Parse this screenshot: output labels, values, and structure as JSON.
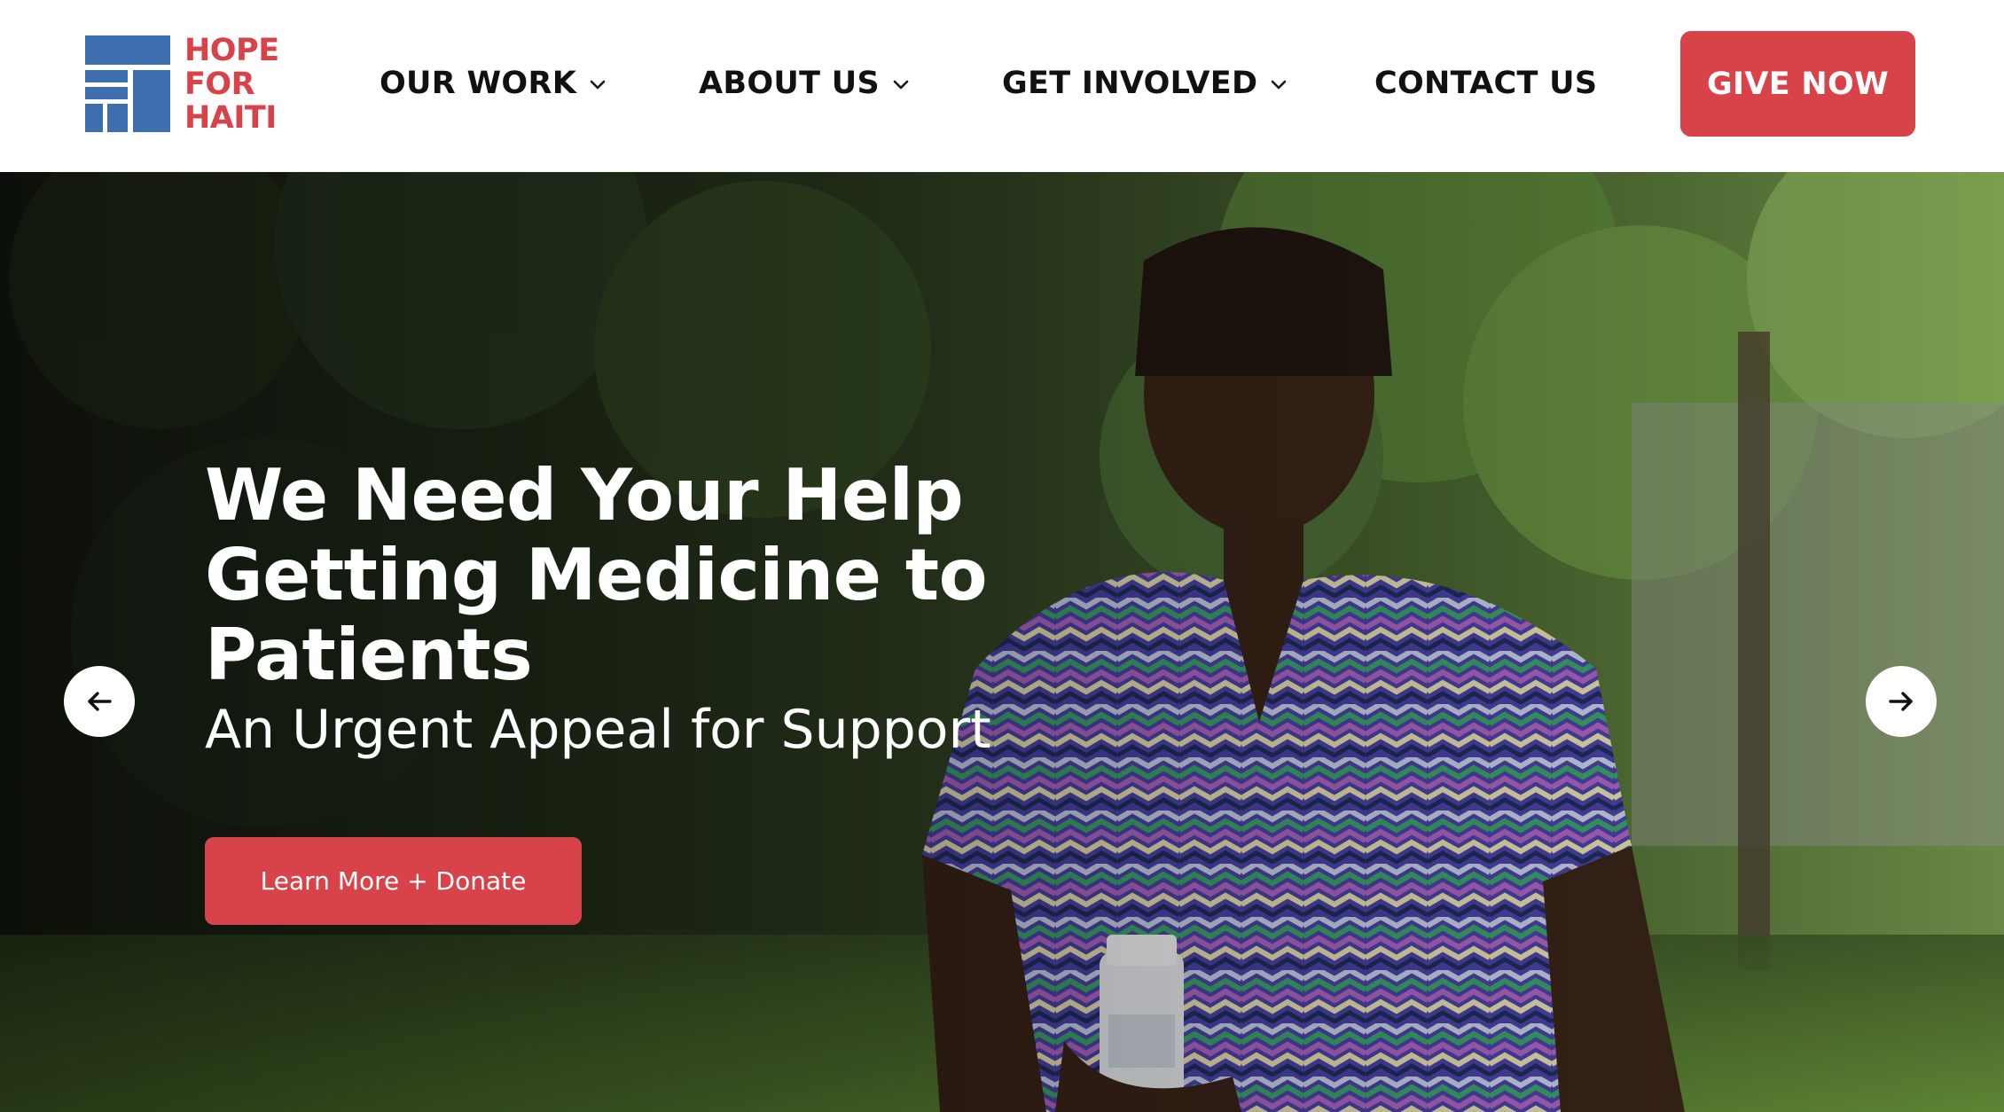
{
  "brand": {
    "logo_lines": [
      "HOPE",
      "FOR",
      "HAITI"
    ],
    "logo_color": "#d8434a",
    "mark_color": "#3d6fb0"
  },
  "nav": {
    "items": [
      {
        "label": "OUR WORK",
        "has_dropdown": true
      },
      {
        "label": "ABOUT US",
        "has_dropdown": true
      },
      {
        "label": "GET INVOLVED",
        "has_dropdown": true
      },
      {
        "label": "CONTACT US",
        "has_dropdown": false
      }
    ],
    "cta_label": "GIVE NOW",
    "accent_color": "#d8434a"
  },
  "hero": {
    "title": "We Need Your Help Getting Medicine to Patients",
    "subtitle": "An Urgent Appeal for Support",
    "button_label": "Learn More + Donate",
    "prev_icon": "arrow-left-icon",
    "next_icon": "arrow-right-icon",
    "image_subject": "woman-in-patterned-dress-holding-medicine-bottle"
  }
}
